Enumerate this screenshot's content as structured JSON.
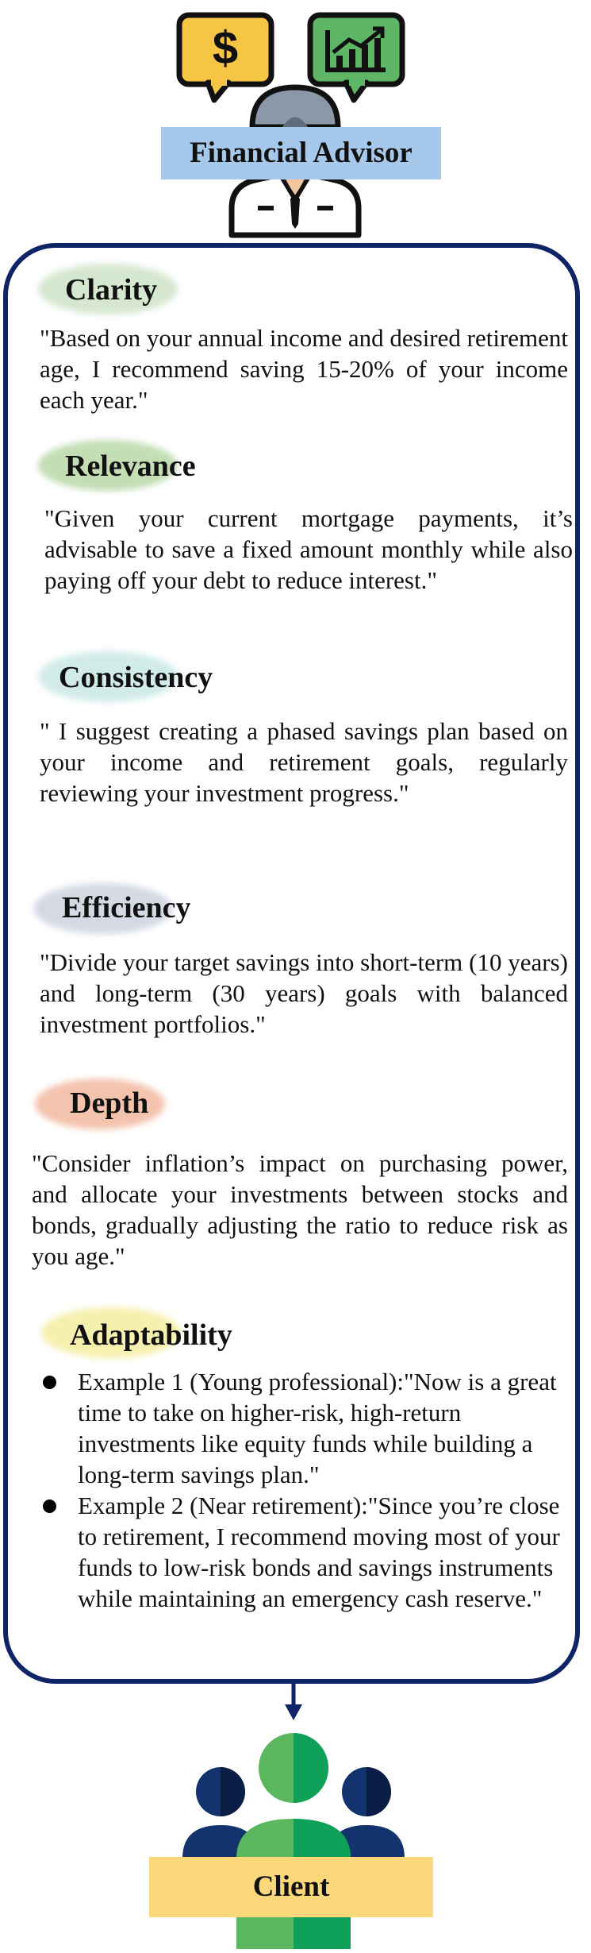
{
  "advisor": {
    "label": "Financial Advisor"
  },
  "sections": {
    "clarity": {
      "heading": "Clarity",
      "text": "\"Based on your annual income and desired retirement age, I recommend saving 15-20% of your income each year.\""
    },
    "relevance": {
      "heading": "Relevance",
      "text": "\"Given your current mortgage payments, it’s advisable to save a fixed amount monthly while also paying off your debt to reduce interest.\""
    },
    "consistency": {
      "heading": "Consistency",
      "text": "\" I suggest creating a phased savings plan based on your income and retirement goals, regularly reviewing your investment progress.\""
    },
    "efficiency": {
      "heading": "Efficiency",
      "text": "\"Divide your target savings into short-term (10 years) and long-term (30 years) goals with balanced investment portfolios.\""
    },
    "depth": {
      "heading": "Depth",
      "text": "\"Consider inflation’s impact on purchasing power, and allocate your investments between stocks and bonds, gradually adjusting the ratio to reduce risk as you age.\""
    },
    "adaptability": {
      "heading": "Adaptability",
      "examples": [
        "Example 1 (Young professional):\"Now is a great time to take on higher-risk, high-return investments like equity funds while building a long-term savings plan.\"",
        "Example 2 (Near retirement):\"Since you’re close to retirement, I recommend moving most of your funds to low-risk bonds and savings instruments while maintaining an emergency cash reserve.\""
      ]
    }
  },
  "client": {
    "label": "Client"
  },
  "colors": {
    "panel_border": "#0e2466",
    "advisor_label_bg": "#a6c8ea",
    "client_label_bg": "#f9d77a",
    "clarity_blob": "#cfe3c8",
    "relevance_blob": "#b9d8a8",
    "consistency_blob": "#c9e8e6",
    "efficiency_blob": "#cdd3df",
    "depth_blob": "#f2b9a0",
    "adaptability_blob": "#f4eea0"
  },
  "icons": {
    "dollar_bubble": "dollar-speech-bubble-icon",
    "chart_bubble": "growth-chart-speech-bubble-icon",
    "advisor_person": "advisor-person-icon",
    "client_group": "client-group-icon"
  }
}
